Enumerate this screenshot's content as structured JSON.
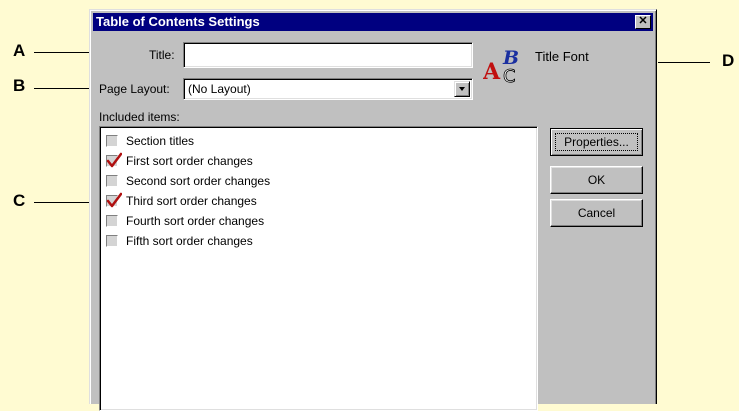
{
  "callouts": {
    "a": "A",
    "b": "B",
    "c": "C",
    "d": "D"
  },
  "dialog": {
    "title": "Table of Contents Settings",
    "close_glyph": "✕",
    "title_label": "Title:",
    "title_value": "",
    "page_layout_label": "Page Layout:",
    "page_layout_value": "(No Layout)",
    "title_font_label": "Title Font",
    "included_label": "Included items:",
    "items": [
      {
        "label": "Section titles",
        "checked": false
      },
      {
        "label": "First sort order changes",
        "checked": true
      },
      {
        "label": "Second sort order changes",
        "checked": false
      },
      {
        "label": "Third sort order changes",
        "checked": true
      },
      {
        "label": "Fourth sort order changes",
        "checked": false
      },
      {
        "label": "Fifth sort order changes",
        "checked": false
      }
    ],
    "buttons": {
      "properties": "Properties...",
      "ok": "OK",
      "cancel": "Cancel"
    }
  },
  "colors": {
    "background": "#fffbd2",
    "titlebar": "#000080",
    "dialog_face": "#c0c0c0",
    "checkmark": "#b01010",
    "font_icon_blue": "#1a2fa0",
    "font_icon_red": "#c01010"
  },
  "icons": {
    "close": "close-icon",
    "dropdown": "chevron-down-icon",
    "font": "font-icon",
    "check": "checkmark-icon"
  }
}
